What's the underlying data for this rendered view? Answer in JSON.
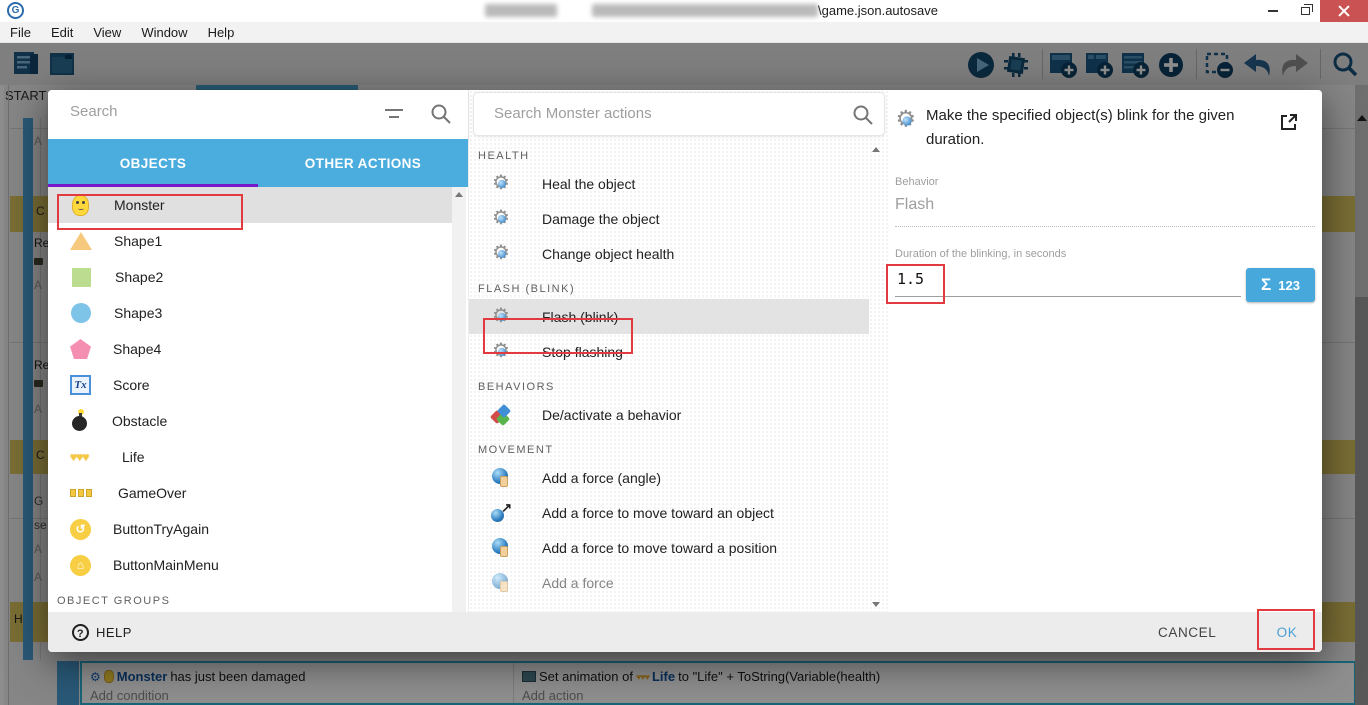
{
  "window": {
    "logo_glyph": "G",
    "title_tail": "\\game.json.autosave",
    "menu": [
      "File",
      "Edit",
      "View",
      "Window",
      "Help"
    ]
  },
  "workspace": {
    "scene_tab": "START",
    "fragments": [
      "A",
      "C",
      "Re",
      "A",
      "Re",
      "A",
      "C",
      "G",
      "se",
      "A",
      "A",
      "H"
    ],
    "event_row": {
      "condition_object": "Monster",
      "condition_text": "has just been damaged",
      "add_condition": "Add condition",
      "action_prefix": "Set animation of",
      "action_object": "Life",
      "action_suffix": " to \"Life\" + ToString(Variable(health)",
      "add_action": "Add action"
    }
  },
  "dialog": {
    "objects_panel": {
      "search_placeholder": "Search",
      "tabs": [
        {
          "label": "OBJECTS",
          "active": true
        },
        {
          "label": "OTHER ACTIONS",
          "active": false
        }
      ],
      "items": [
        {
          "label": "Monster",
          "selected": true
        },
        {
          "label": "Shape1"
        },
        {
          "label": "Shape2"
        },
        {
          "label": "Shape3"
        },
        {
          "label": "Shape4"
        },
        {
          "label": "Score"
        },
        {
          "label": "Obstacle"
        },
        {
          "label": "Life"
        },
        {
          "label": "GameOver"
        },
        {
          "label": "ButtonTryAgain"
        },
        {
          "label": "ButtonMainMenu"
        }
      ],
      "groups_header": "OBJECT GROUPS"
    },
    "actions_panel": {
      "search_placeholder": "Search Monster actions",
      "sections": [
        {
          "title": "HEALTH",
          "items": [
            {
              "label": "Heal the object"
            },
            {
              "label": "Damage the object"
            },
            {
              "label": "Change object health"
            }
          ]
        },
        {
          "title": "FLASH (BLINK)",
          "items": [
            {
              "label": "Flash (blink)",
              "selected": true
            },
            {
              "label": "Stop flashing"
            }
          ]
        },
        {
          "title": "BEHAVIORS",
          "items": [
            {
              "label": "De/activate a behavior"
            }
          ]
        },
        {
          "title": "MOVEMENT",
          "items": [
            {
              "label": "Add a force (angle)"
            },
            {
              "label": "Add a force to move toward an object"
            },
            {
              "label": "Add a force to move toward a position"
            },
            {
              "label": "Add a force"
            }
          ]
        }
      ]
    },
    "details_panel": {
      "description": "Make the specified object(s) blink for the given duration.",
      "behavior_label": "Behavior",
      "behavior_value": "Flash",
      "duration_label": "Duration of the blinking, in seconds",
      "duration_value": "1.5",
      "expr_number": "123"
    },
    "footer": {
      "help_label": "HELP",
      "cancel_label": "CANCEL",
      "ok_label": "OK"
    }
  },
  "icons": {
    "score_glyph": "Tx",
    "life_glyph": "♥♥♥",
    "retry_glyph": "↺",
    "home_glyph": "⌂",
    "sigma": "Σ",
    "question": "?"
  }
}
